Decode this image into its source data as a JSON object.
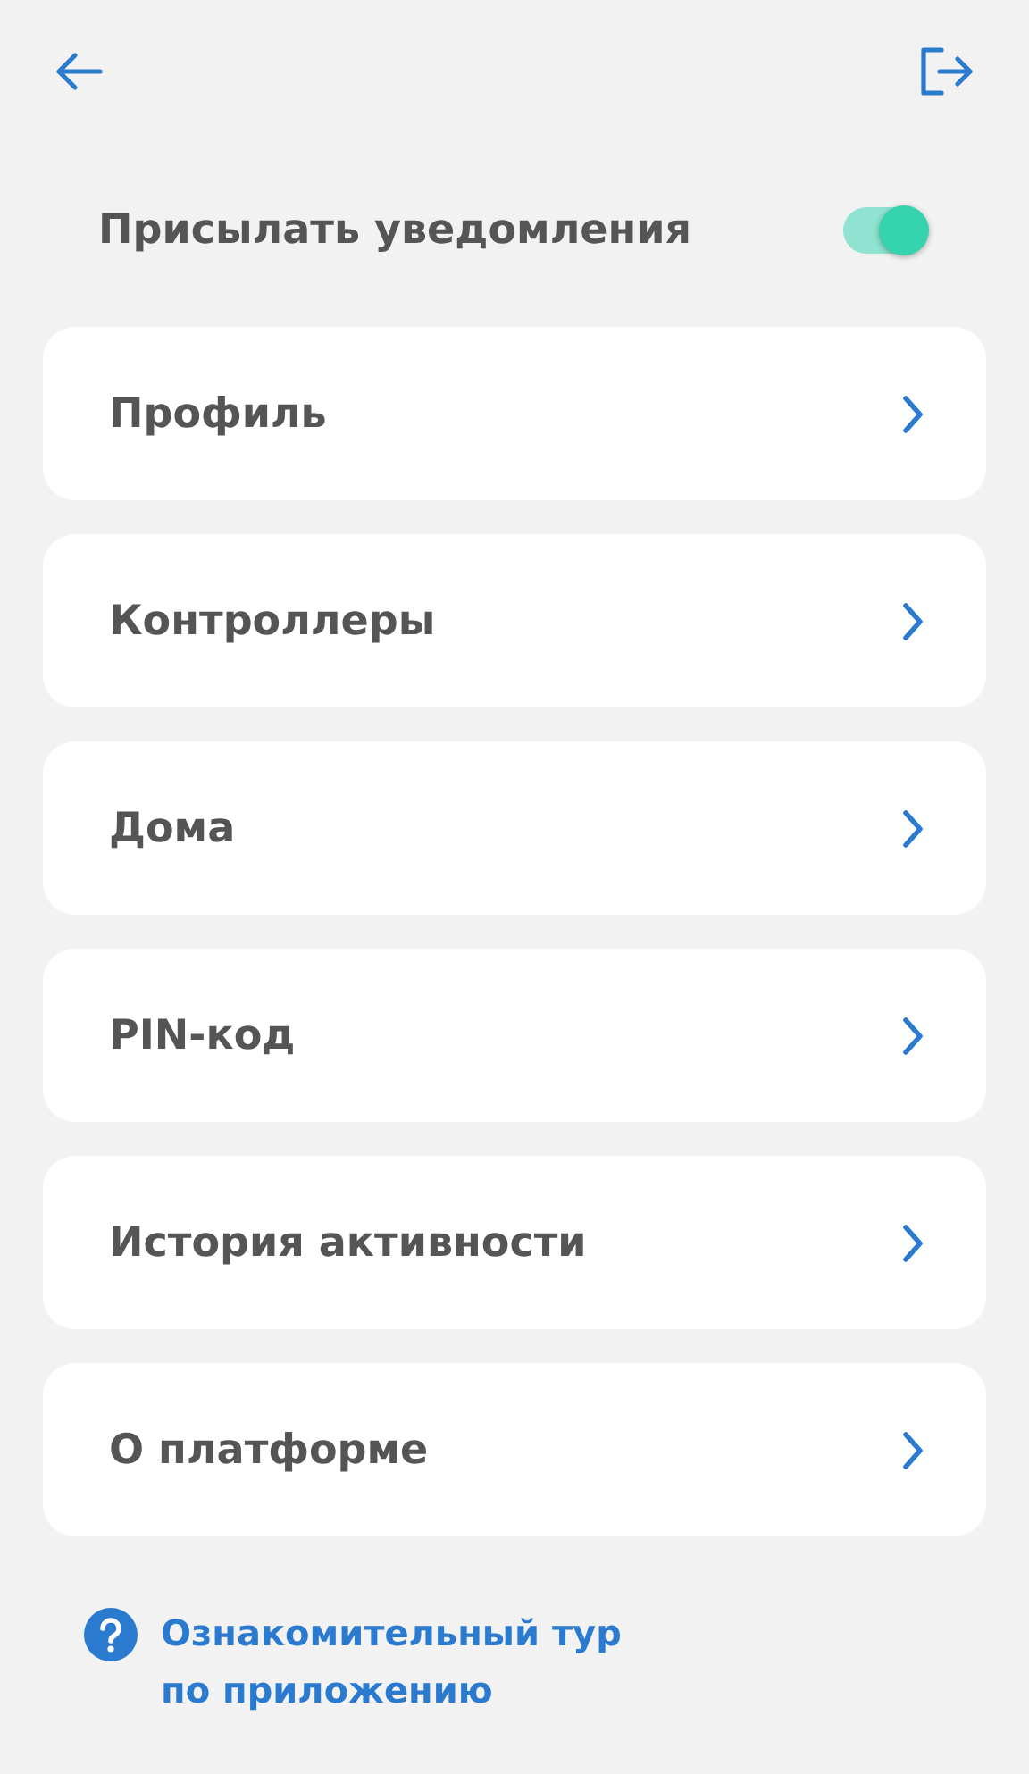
{
  "notifications": {
    "label": "Присылать уведомления",
    "on": true
  },
  "menu": [
    {
      "label": "Профиль"
    },
    {
      "label": "Контроллеры"
    },
    {
      "label": "Дома"
    },
    {
      "label": "PIN-код"
    },
    {
      "label": "История активности"
    },
    {
      "label": "О платформе"
    }
  ],
  "help": {
    "lines": [
      "Ознакомительный тур",
      "по приложению"
    ]
  }
}
